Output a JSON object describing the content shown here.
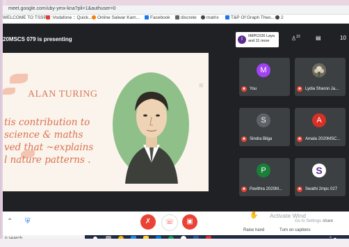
{
  "browser": {
    "url": "meet.google.com/uby-ymx-kna?pli=1&authuser=0",
    "bookmarks": [
      {
        "label": "WELCOME TO TSSP...",
        "color": "#6d6d6d"
      },
      {
        "label": ":Vodafone :: Quick...",
        "color": "#e53935"
      },
      {
        "label": "Online Salwar Kam...",
        "color": "#f57c00"
      },
      {
        "label": "Facebook",
        "color": "#1877f2"
      },
      {
        "label": "discrete",
        "color": "#616161"
      },
      {
        "label": "matrix",
        "color": "#424242"
      },
      {
        "label": "T&P Of Graph Theo...",
        "color": "#1a73e8"
      },
      {
        "label": "2",
        "color": "#424242"
      }
    ]
  },
  "meet": {
    "presenting_text": "20MSCS 079 is presenting",
    "chip": {
      "badge": "I",
      "text": "IIMPC026 Laya and 11 more"
    },
    "people_count": "22",
    "top_number": "10"
  },
  "slide": {
    "title": "ALAN TURING",
    "quote_lines": [
      "tis contribution to",
      "science & maths",
      "ved that ~explains",
      "l nature patterns ."
    ]
  },
  "participants": [
    {
      "name": "You",
      "initial": "M",
      "color": "#a142f4"
    },
    {
      "name": "Lydia Sharon Ja...",
      "initial": "",
      "color": "#5f6368"
    },
    {
      "name": "Sindra Bilga",
      "initial": "S",
      "color": "#5f6368"
    },
    {
      "name": "Amala 2020MSC...",
      "initial": "A",
      "color": "#d93025"
    },
    {
      "name": "Pavithra 2020M...",
      "initial": "P",
      "color": "#188038"
    },
    {
      "name": "Swathi 2mpc 027",
      "initial": "S",
      "color": "#ffffff"
    }
  ],
  "controls": {
    "raise_hand": "Raise hand",
    "captions": "Turn on captions",
    "watermark_line1": "Activate Wind",
    "watermark_line2": "Go to Settings",
    "watermark_extra": "share"
  },
  "taskbar": {
    "search": "p search",
    "tray": "^ ☁"
  }
}
